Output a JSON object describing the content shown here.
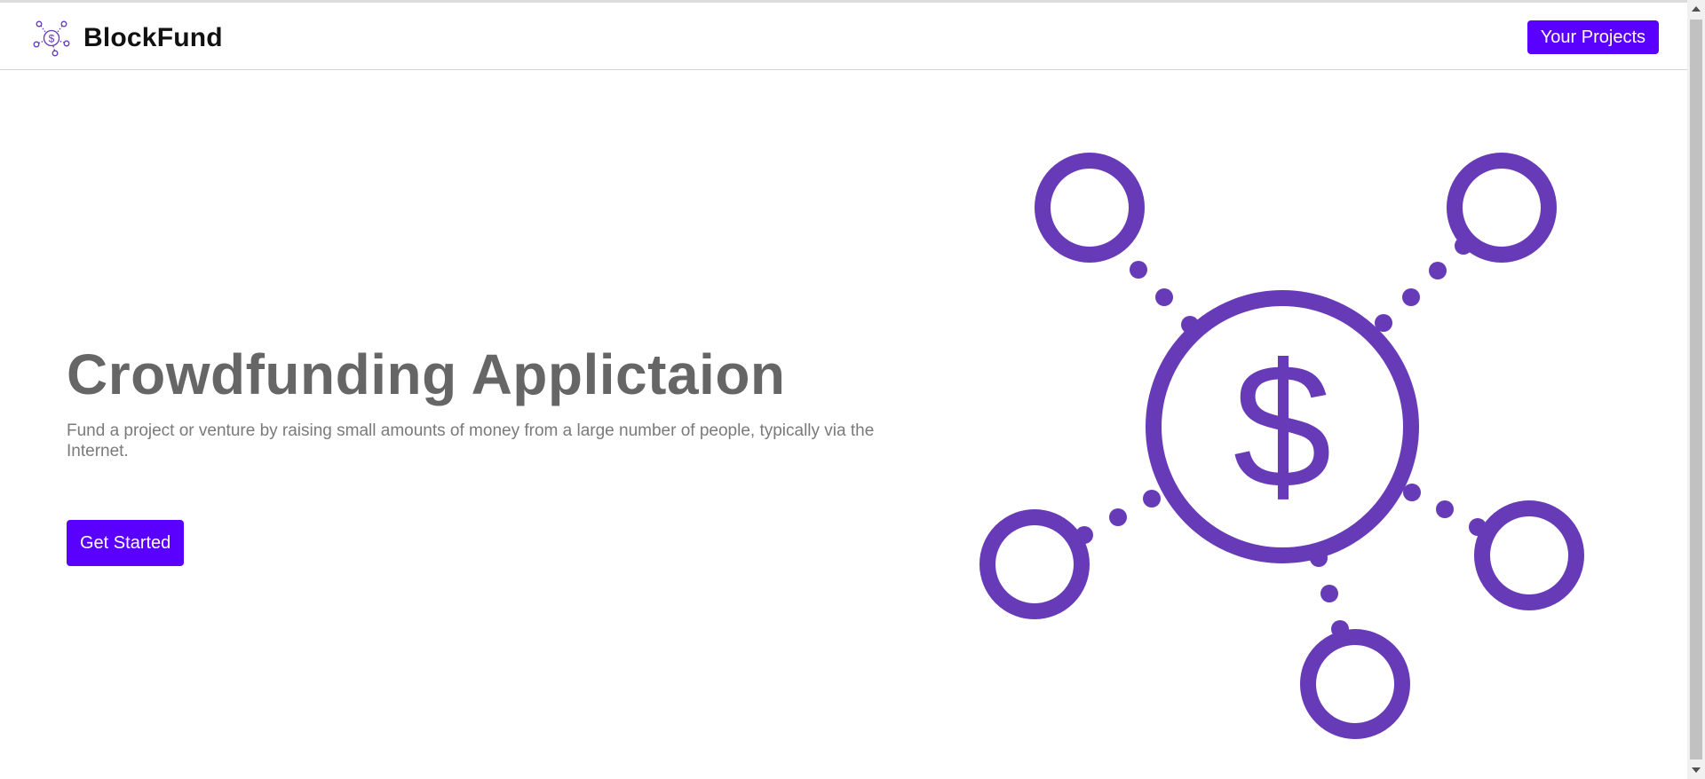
{
  "navbar": {
    "brand_name": "BlockFund",
    "brand_icon": "network-dollar-logo-icon",
    "projects_button": "Your Projects"
  },
  "hero": {
    "title": "Crowdfunding Applictaion",
    "subtitle": "Fund a project or venture by raising small amounts of money from a large number of people, typically via the Internet.",
    "cta_button": "Get Started",
    "illustration_icon": "network-dollar-icon",
    "illustration_glyph": "$"
  },
  "colors": {
    "accent": "#5a00ff",
    "illustration": "#673ab7",
    "heading": "#666666",
    "subtext": "#7a7a7a"
  }
}
